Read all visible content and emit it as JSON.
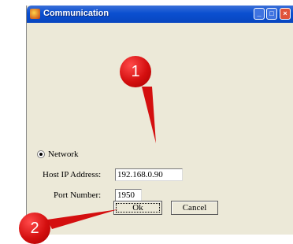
{
  "window": {
    "title": "Communication",
    "controls": {
      "minimize": "_",
      "maximize": "□",
      "close": "×"
    }
  },
  "connection": {
    "selected_option": "Network",
    "host_ip_label": "Host IP Address:",
    "host_ip_value": "192.168.0.90",
    "port_label": "Port Number:",
    "port_value": "1950"
  },
  "buttons": {
    "ok": "Ok",
    "cancel": "Cancel"
  },
  "callouts": [
    "1",
    "2"
  ],
  "colors": {
    "titlebar": "#0a4fd0",
    "dialog_bg": "#ece9d8",
    "callout": "#d40f0f"
  }
}
